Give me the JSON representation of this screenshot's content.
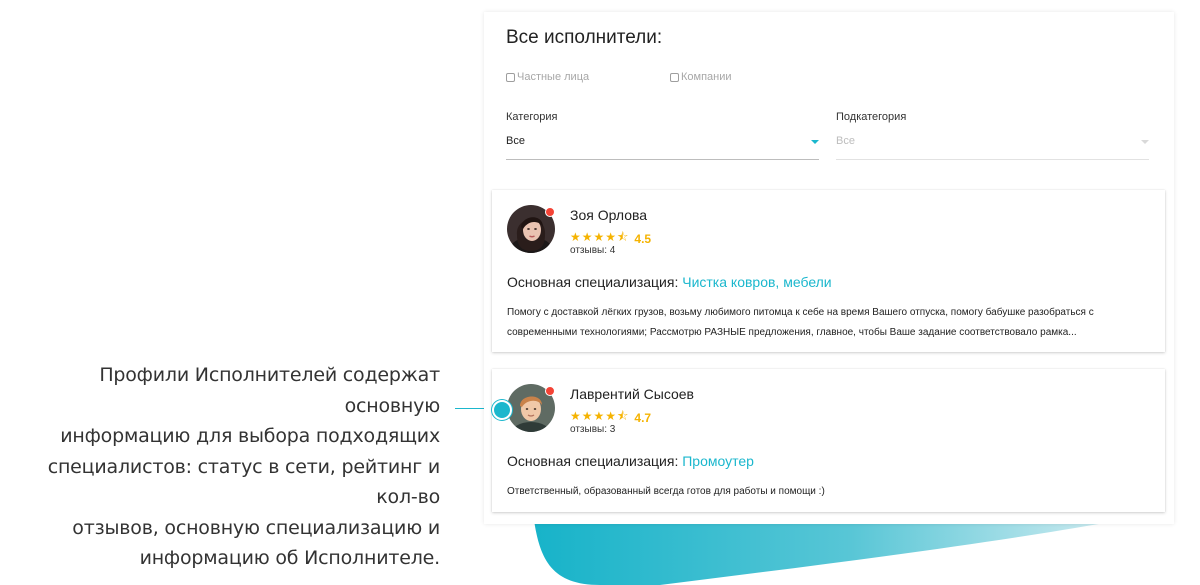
{
  "colors": {
    "accent": "#1bb7cd",
    "star": "#f5b301",
    "online_dot": "#f44336"
  },
  "annotation": {
    "lines": [
      "Профили Исполнителей содержат основную",
      "информацию для выбора подходящих",
      "специалистов: статус в сети, рейтинг и кол-во",
      "отзывов, основную специализацию и",
      "информацию об Исполнителе."
    ]
  },
  "panel": {
    "title": "Все исполнители:",
    "filters": {
      "private_label": "Частные лица",
      "company_label": "Компании"
    },
    "category": {
      "label": "Категория",
      "value": "Все"
    },
    "subcategory": {
      "label": "Подкатегория",
      "value": "Все"
    }
  },
  "performers": [
    {
      "name": "Зоя Орлова",
      "stars": "★★★★⯪",
      "rating": "4.5",
      "reviews": "отзывы: 4",
      "spec_prefix": "Основная специализация:",
      "spec": "Чистка ковров, мебели",
      "description": "Помогу с доставкой лёгких грузов, возьму любимого питомца к себе на время Вашего отпуска, помогу бабушке разобраться с современными технологиями; Рассмотрю РАЗНЫЕ предложения, главное, чтобы Ваше задание соответствовало рамка...",
      "online": true
    },
    {
      "name": "Лаврентий Сысоев",
      "stars": "★★★★⯪",
      "rating": "4.7",
      "reviews": "отзывы: 3",
      "spec_prefix": "Основная специализация:",
      "spec": "Промоутер",
      "description": "Ответственный, образованный всегда готов для работы и помощи :)",
      "online": true
    }
  ]
}
